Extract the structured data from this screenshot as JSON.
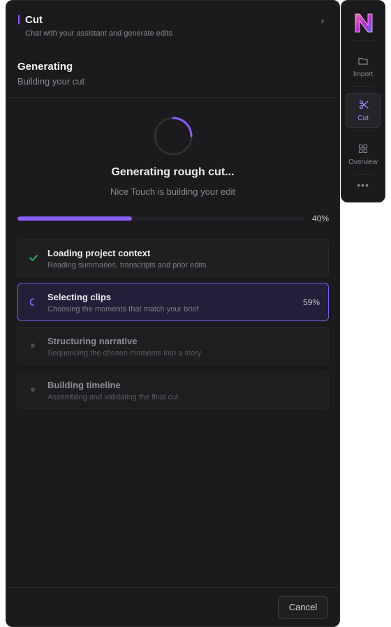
{
  "header": {
    "title": "Cut",
    "subtitle": "Chat with your assistant and generate edits",
    "collapse_icon": "chevron-right-icon"
  },
  "status": {
    "title": "Generating",
    "subtitle": "Building your cut"
  },
  "generation": {
    "title": "Generating rough cut...",
    "subtitle": "Nice Touch is building your edit",
    "progress": 0.4,
    "progress_label": "40%"
  },
  "steps": [
    {
      "title": "Loading project context",
      "description": "Reading summaries, transcripts and prior edits",
      "state": "done",
      "icon": "check-icon"
    },
    {
      "title": "Selecting clips",
      "description": "Choosing the moments that match your brief",
      "state": "active",
      "percent": "59%",
      "icon": "spinner-icon"
    },
    {
      "title": "Structuring narrative",
      "description": "Sequencing the chosen moments into a story",
      "state": "pending",
      "icon": "dot-icon"
    },
    {
      "title": "Building timeline",
      "description": "Assembling and validating the final cut",
      "state": "pending",
      "icon": "dot-icon"
    }
  ],
  "footer": {
    "cancel_label": "Cancel"
  },
  "rail": {
    "logo": "N",
    "items": [
      {
        "label": "Import",
        "icon": "folder-icon"
      },
      {
        "label": "Cut",
        "icon": "scissors-icon",
        "active": true
      },
      {
        "label": "Overview",
        "icon": "grid-icon"
      }
    ],
    "more_label": "•••"
  },
  "colors": {
    "accent": "#8b5cf6",
    "panel_bg": "#1b1b1d",
    "success": "#22c55e"
  }
}
